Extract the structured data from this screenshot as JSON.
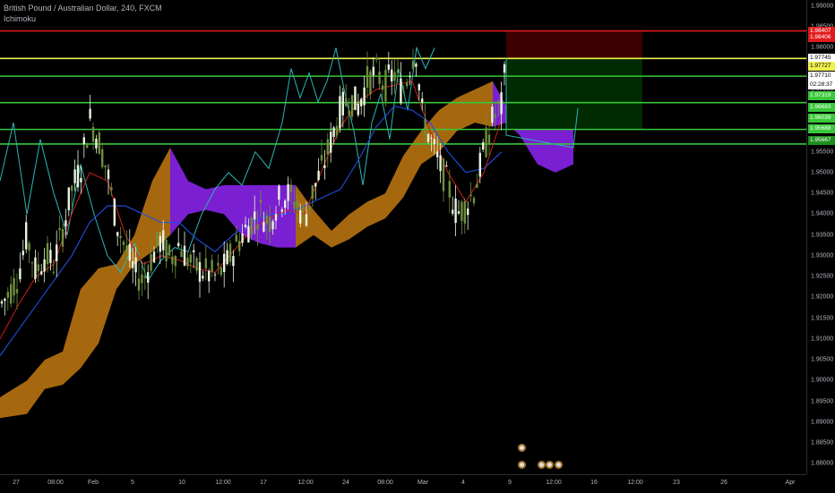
{
  "header": {
    "symbol": "British Pound / Australian Dollar, 240, FXCM",
    "indicator": "Ichimoku"
  },
  "colors": {
    "background": "#000000",
    "bull": "#e8f5dc",
    "bear": "#6d8f3b",
    "tenkan": "#d11e1e",
    "kijun": "#1f4fe0",
    "chikou": "#2bb7b7",
    "kumo_bull": "#a5680f",
    "kumo_bear": "#7a1fd1",
    "stop_line": "#e01b1b",
    "entry_line": "#f0f050",
    "target_line": "#38c838",
    "risk_zone": "#3d0000",
    "reward_zone": "#002b00"
  },
  "price_axis": {
    "ticks": [
      "1.99000",
      "1.98500",
      "1.98000",
      "1.97500",
      "1.97000",
      "1.96500",
      "1.96000",
      "1.95500",
      "1.95000",
      "1.94500",
      "1.94000",
      "1.93500",
      "1.93000",
      "1.92500",
      "1.92000",
      "1.91500",
      "1.91000",
      "1.90500",
      "1.90000",
      "1.89500",
      "1.89000",
      "1.88500",
      "1.88000"
    ],
    "tags": [
      {
        "label": "1.98407",
        "price": 1.98407,
        "bg": "#e01b1b",
        "fg": "#ffffff"
      },
      {
        "label": "1.98406",
        "price": 1.98236,
        "bg": "#e01b1b",
        "fg": "#ffffff"
      },
      {
        "label": "1.97745",
        "price": 1.97745,
        "bg": "#ffffff",
        "fg": "#000000"
      },
      {
        "label": "1.97727",
        "price": 1.9756,
        "bg": "#f0f050",
        "fg": "#000000"
      },
      {
        "label": "1.97710",
        "price": 1.9733,
        "bg": "#ffffff",
        "fg": "#000000"
      },
      {
        "label": "02:28:37",
        "price": 1.971,
        "bg": "#ffffff",
        "fg": "#000000"
      },
      {
        "label": "1.97319",
        "price": 1.9684,
        "bg": "#38c838",
        "fg": "#ffffff"
      },
      {
        "label": "1.96683",
        "price": 1.9657,
        "bg": "#38c838",
        "fg": "#ffffff"
      },
      {
        "label": "1.96039",
        "price": 1.9632,
        "bg": "#38c838",
        "fg": "#ffffff"
      },
      {
        "label": "1.95688",
        "price": 1.9606,
        "bg": "#38c838",
        "fg": "#ffffff"
      },
      {
        "label": "1.95667",
        "price": 1.9577,
        "bg": "#1b8f1b",
        "fg": "#ffffff"
      }
    ]
  },
  "time_axis": {
    "labels": [
      {
        "text": "27",
        "x": 18
      },
      {
        "text": "08:00",
        "x": 62
      },
      {
        "text": "Feb",
        "x": 104
      },
      {
        "text": "5",
        "x": 148
      },
      {
        "text": "10",
        "x": 203
      },
      {
        "text": "12:00",
        "x": 249
      },
      {
        "text": "17",
        "x": 294
      },
      {
        "text": "12:00",
        "x": 341
      },
      {
        "text": "24",
        "x": 386
      },
      {
        "text": "08:00",
        "x": 430
      },
      {
        "text": "Mar",
        "x": 472
      },
      {
        "text": "4",
        "x": 517
      },
      {
        "text": "9",
        "x": 569
      },
      {
        "text": "12:00",
        "x": 618
      },
      {
        "text": "16",
        "x": 663
      },
      {
        "text": "12:00",
        "x": 709
      },
      {
        "text": "23",
        "x": 755
      },
      {
        "text": "26",
        "x": 808
      },
      {
        "text": "Apr",
        "x": 882
      }
    ]
  },
  "chart_data": {
    "type": "candlestick",
    "title": "British Pound / Australian Dollar, 240, FXCM",
    "indicator": "Ichimoku",
    "ylim": [
      1.8775,
      1.9915
    ],
    "y_ticks": [
      1.99,
      1.985,
      1.98,
      1.975,
      1.97,
      1.965,
      1.96,
      1.955,
      1.95,
      1.945,
      1.94,
      1.935,
      1.93,
      1.925,
      1.92,
      1.915,
      1.91,
      1.905,
      1.9,
      1.895,
      1.89,
      1.885,
      1.88
    ],
    "levels": [
      {
        "name": "stop",
        "price": 1.98407
      },
      {
        "name": "entry",
        "price": 1.97745
      },
      {
        "name": "target-1",
        "price": 1.97319
      },
      {
        "name": "target-2",
        "price": 1.96683
      },
      {
        "name": "target-3",
        "price": 1.96039
      },
      {
        "name": "target-4",
        "price": 1.95688
      }
    ],
    "position": {
      "entry": 1.97745,
      "stop": 1.98407,
      "target": 1.96039
    },
    "price_path": [
      [
        0,
        1.918
      ],
      [
        10,
        1.921
      ],
      [
        20,
        1.925
      ],
      [
        30,
        1.935
      ],
      [
        40,
        1.926
      ],
      [
        50,
        1.93
      ],
      [
        60,
        1.928
      ],
      [
        70,
        1.936
      ],
      [
        80,
        1.946
      ],
      [
        90,
        1.951
      ],
      [
        100,
        1.963
      ],
      [
        110,
        1.958
      ],
      [
        120,
        1.95
      ],
      [
        130,
        1.938
      ],
      [
        140,
        1.932
      ],
      [
        150,
        1.926
      ],
      [
        160,
        1.924
      ],
      [
        170,
        1.93
      ],
      [
        180,
        1.934
      ],
      [
        190,
        1.929
      ],
      [
        200,
        1.933
      ],
      [
        210,
        1.929
      ],
      [
        220,
        1.927
      ],
      [
        230,
        1.926
      ],
      [
        240,
        1.925
      ],
      [
        250,
        1.927
      ],
      [
        260,
        1.931
      ],
      [
        270,
        1.935
      ],
      [
        280,
        1.938
      ],
      [
        290,
        1.941
      ],
      [
        300,
        1.938
      ],
      [
        310,
        1.943
      ],
      [
        320,
        1.945
      ],
      [
        330,
        1.943
      ],
      [
        340,
        1.939
      ],
      [
        350,
        1.946
      ],
      [
        360,
        1.951
      ],
      [
        370,
        1.958
      ],
      [
        380,
        1.965
      ],
      [
        390,
        1.968
      ],
      [
        400,
        1.966
      ],
      [
        410,
        1.972
      ],
      [
        420,
        1.974
      ],
      [
        430,
        1.971
      ],
      [
        440,
        1.974
      ],
      [
        450,
        1.969
      ],
      [
        460,
        1.978
      ],
      [
        465,
        1.979
      ],
      [
        470,
        1.965
      ],
      [
        480,
        1.958
      ],
      [
        490,
        1.952
      ],
      [
        500,
        1.947
      ],
      [
        510,
        1.94
      ],
      [
        520,
        1.942
      ],
      [
        530,
        1.946
      ],
      [
        540,
        1.955
      ],
      [
        550,
        1.963
      ],
      [
        560,
        1.966
      ],
      [
        565,
        1.977
      ]
    ],
    "tenkan": [
      [
        0,
        1.91
      ],
      [
        20,
        1.918
      ],
      [
        40,
        1.925
      ],
      [
        60,
        1.928
      ],
      [
        80,
        1.94
      ],
      [
        100,
        1.95
      ],
      [
        120,
        1.948
      ],
      [
        140,
        1.935
      ],
      [
        160,
        1.928
      ],
      [
        180,
        1.93
      ],
      [
        200,
        1.929
      ],
      [
        220,
        1.927
      ],
      [
        240,
        1.926
      ],
      [
        260,
        1.931
      ],
      [
        280,
        1.936
      ],
      [
        300,
        1.939
      ],
      [
        320,
        1.941
      ],
      [
        340,
        1.94
      ],
      [
        360,
        1.951
      ],
      [
        380,
        1.961
      ],
      [
        400,
        1.967
      ],
      [
        420,
        1.97
      ],
      [
        440,
        1.971
      ],
      [
        460,
        1.972
      ],
      [
        480,
        1.96
      ],
      [
        500,
        1.95
      ],
      [
        520,
        1.943
      ],
      [
        540,
        1.95
      ],
      [
        560,
        1.963
      ]
    ],
    "kijun": [
      [
        0,
        1.906
      ],
      [
        20,
        1.912
      ],
      [
        40,
        1.918
      ],
      [
        60,
        1.924
      ],
      [
        80,
        1.93
      ],
      [
        100,
        1.938
      ],
      [
        120,
        1.942
      ],
      [
        140,
        1.942
      ],
      [
        160,
        1.94
      ],
      [
        180,
        1.938
      ],
      [
        200,
        1.938
      ],
      [
        220,
        1.934
      ],
      [
        240,
        1.931
      ],
      [
        260,
        1.935
      ],
      [
        280,
        1.938
      ],
      [
        300,
        1.94
      ],
      [
        320,
        1.94
      ],
      [
        340,
        1.942
      ],
      [
        360,
        1.944
      ],
      [
        380,
        1.946
      ],
      [
        400,
        1.953
      ],
      [
        420,
        1.961
      ],
      [
        440,
        1.966
      ],
      [
        460,
        1.965
      ],
      [
        480,
        1.962
      ],
      [
        500,
        1.955
      ],
      [
        520,
        1.95
      ],
      [
        540,
        1.951
      ],
      [
        560,
        1.955
      ]
    ],
    "chikou": [
      [
        0,
        1.948
      ],
      [
        15,
        1.962
      ],
      [
        30,
        1.94
      ],
      [
        45,
        1.958
      ],
      [
        60,
        1.945
      ],
      [
        75,
        1.935
      ],
      [
        90,
        1.952
      ],
      [
        105,
        1.94
      ],
      [
        120,
        1.93
      ],
      [
        135,
        1.926
      ],
      [
        150,
        1.933
      ],
      [
        165,
        1.924
      ],
      [
        180,
        1.929
      ],
      [
        195,
        1.932
      ],
      [
        210,
        1.931
      ],
      [
        225,
        1.94
      ],
      [
        240,
        1.946
      ],
      [
        255,
        1.95
      ],
      [
        270,
        1.947
      ],
      [
        285,
        1.955
      ],
      [
        300,
        1.951
      ],
      [
        315,
        1.962
      ],
      [
        325,
        1.975
      ],
      [
        335,
        1.968
      ],
      [
        345,
        1.974
      ],
      [
        355,
        1.967
      ],
      [
        365,
        1.972
      ],
      [
        375,
        1.98
      ],
      [
        385,
        1.969
      ],
      [
        395,
        1.96
      ],
      [
        405,
        1.947
      ],
      [
        415,
        1.962
      ],
      [
        425,
        1.969
      ],
      [
        435,
        1.958
      ],
      [
        445,
        1.975
      ],
      [
        455,
        1.965
      ],
      [
        465,
        1.98
      ],
      [
        475,
        1.975
      ],
      [
        485,
        1.98
      ]
    ],
    "cloud": [
      [
        0,
        1.891,
        1.896
      ],
      [
        30,
        1.892,
        1.9
      ],
      [
        50,
        1.898,
        1.905
      ],
      [
        70,
        1.899,
        1.907
      ],
      [
        90,
        1.903,
        1.922
      ],
      [
        110,
        1.909,
        1.927
      ],
      [
        130,
        1.922,
        1.928
      ],
      [
        150,
        1.928,
        1.935
      ],
      [
        170,
        1.931,
        1.948
      ],
      [
        190,
        1.935,
        1.956
      ],
      [
        210,
        1.94,
        1.948
      ],
      [
        230,
        1.941,
        1.946
      ],
      [
        250,
        1.94,
        1.947
      ],
      [
        270,
        1.935,
        1.947
      ],
      [
        290,
        1.933,
        1.947
      ],
      [
        310,
        1.932,
        1.947
      ],
      [
        330,
        1.932,
        1.947
      ],
      [
        350,
        1.935,
        1.941
      ],
      [
        370,
        1.932,
        1.936
      ],
      [
        390,
        1.934,
        1.94
      ],
      [
        410,
        1.937,
        1.943
      ],
      [
        430,
        1.939,
        1.945
      ],
      [
        450,
        1.944,
        1.954
      ],
      [
        470,
        1.952,
        1.96
      ],
      [
        490,
        1.955,
        1.965
      ],
      [
        510,
        1.96,
        1.968
      ],
      [
        530,
        1.962,
        1.97
      ],
      [
        550,
        1.961,
        1.972
      ],
      [
        565,
        1.962,
        1.966
      ],
      [
        580,
        1.959,
        1.961
      ],
      [
        600,
        1.952,
        1.961
      ],
      [
        620,
        1.95,
        1.961
      ],
      [
        640,
        1.952,
        1.961
      ]
    ]
  }
}
